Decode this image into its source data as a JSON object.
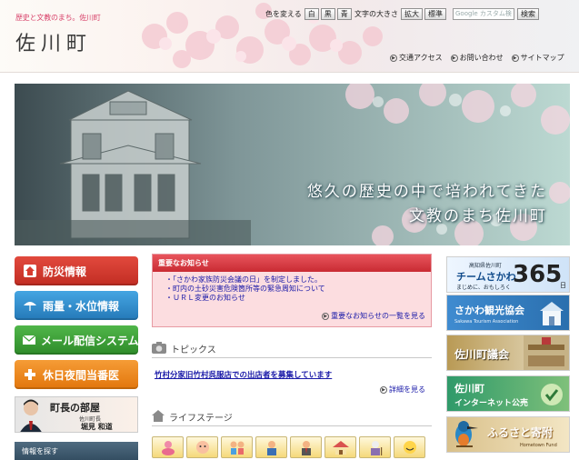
{
  "header": {
    "tagline": "歴史と文教のまち。佐川町",
    "town_name": "佐川町",
    "color_label": "色を変える",
    "color_options": [
      "白",
      "黒",
      "青"
    ],
    "text_size_label": "文字の大きさ",
    "text_size_options": [
      "拡大",
      "標準"
    ],
    "search_placeholder": "Google カスタム検",
    "search_button": "検索",
    "top_links": [
      "交通アクセス",
      "お問い合わせ",
      "サイトマップ"
    ]
  },
  "hero": {
    "line1": "悠久の歴史の中で培われてきた",
    "line2": "文教のまち佐川町"
  },
  "left_nav": {
    "buttons": [
      {
        "label": "防災情報",
        "color": "#d63b2f",
        "icon": "house-icon"
      },
      {
        "label": "雨量・水位情報",
        "color": "#2f8fd0",
        "icon": "umbrella-icon"
      },
      {
        "label": "メール配信システム",
        "color": "#3ea43a",
        "icon": "mail-icon"
      },
      {
        "label": "休日夜間当番医",
        "color": "#f08a1c",
        "icon": "medical-cross-icon"
      }
    ],
    "mayor": {
      "title": "町長の部屋",
      "sub": "佐川町長",
      "name": "堀見 和道"
    },
    "info_search": "情報を探す"
  },
  "notice": {
    "title": "重要なお知らせ",
    "items": [
      "「さかわ家族防災会議の日」を制定しました。",
      "町内の土砂災害危険箇所等の緊急周知について",
      "ＵＲＬ変更のお知らせ"
    ],
    "more": "重要なお知らせの一覧を見る"
  },
  "topics": {
    "title": "トピックス",
    "item": "竹村分家旧竹村呉服店での出店者を募集しています",
    "more": "詳細を見る"
  },
  "life_stage": {
    "title": "ライフステージ",
    "icons": [
      "pregnancy-icon",
      "baby-icon",
      "children-icon",
      "school-icon",
      "work-icon",
      "family-icon",
      "elderly-icon",
      "smile-icon"
    ]
  },
  "right_banners": {
    "team": {
      "small": "高知県佐川町",
      "name": "チームさかわ",
      "tag": "まじめに、おもしろく",
      "number": "365",
      "unit": "日"
    },
    "tourism": {
      "title": "さかわ観光協会",
      "sub": "Sakawa Tourism Association"
    },
    "council": {
      "title": "佐川町議会"
    },
    "internet": {
      "line1": "佐川町",
      "line2": "インターネット公売"
    },
    "furusato": {
      "title": "ふるさと寄附",
      "sub": "Hometown Fund"
    }
  },
  "colors": {
    "brand_pink": "#d8426a",
    "notice_red": "#d63b2f",
    "link_blue": "#1a1aa8"
  }
}
